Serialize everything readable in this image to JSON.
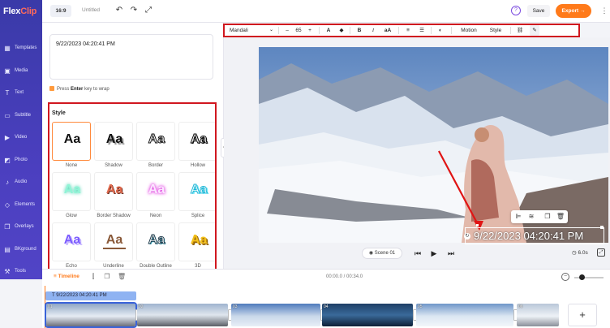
{
  "app": {
    "logo_main": "Flex",
    "logo_accent": "Clip"
  },
  "nav": [
    {
      "label": "Templates",
      "icon": "templates-icon",
      "glyph": "▦"
    },
    {
      "label": "Media",
      "icon": "media-icon",
      "glyph": "▣"
    },
    {
      "label": "Text",
      "icon": "text-icon",
      "glyph": "T"
    },
    {
      "label": "Subtitle",
      "icon": "subtitle-icon",
      "glyph": "▭"
    },
    {
      "label": "Video",
      "icon": "video-icon",
      "glyph": "▶"
    },
    {
      "label": "Photo",
      "icon": "photo-icon",
      "glyph": "◩"
    },
    {
      "label": "Audio",
      "icon": "audio-icon",
      "glyph": "♪"
    },
    {
      "label": "Elements",
      "icon": "elements-icon",
      "glyph": "◇"
    },
    {
      "label": "Overlays",
      "icon": "overlays-icon",
      "glyph": "❐"
    },
    {
      "label": "BKground",
      "icon": "background-icon",
      "glyph": "▤"
    },
    {
      "label": "Tools",
      "icon": "tools-icon",
      "glyph": "⚒"
    }
  ],
  "topbar": {
    "ratio": "16:9",
    "title": "Untitled",
    "save": "Save",
    "export": "Export →",
    "help": "?"
  },
  "texttoolbar": {
    "font": "Mandali",
    "font_size": "65",
    "minus": "–",
    "plus": "+",
    "motion": "Motion",
    "style": "Style"
  },
  "panel": {
    "text_value": "9/22/2023 04:20:41 PM",
    "hint_prefix": "Press ",
    "hint_key": "Enter",
    "hint_suffix": " key to wrap",
    "style_title": "Style",
    "styles": [
      {
        "name": "None",
        "sample": "Aa"
      },
      {
        "name": "Shadow",
        "sample": "Aa"
      },
      {
        "name": "Border",
        "sample": "Aa"
      },
      {
        "name": "Hollow",
        "sample": "Aa"
      },
      {
        "name": "Glow",
        "sample": "Aa"
      },
      {
        "name": "Border Shadow",
        "sample": "Aa"
      },
      {
        "name": "Neon",
        "sample": "Aa"
      },
      {
        "name": "Splice",
        "sample": "Aa"
      },
      {
        "name": "Echo",
        "sample": "Aa"
      },
      {
        "name": "Underline",
        "sample": "Aa"
      },
      {
        "name": "Double Outline",
        "sample": "Aa"
      },
      {
        "name": "3D",
        "sample": "Aa"
      }
    ]
  },
  "canvas": {
    "overlay_text": "9/22/2023 04:20:41 PM",
    "scene_label": "Scene 01",
    "duration": "6.0s"
  },
  "timeline": {
    "tab": "Timeline",
    "time": "00:00.0 / 00:34.0",
    "text_track": "9/22/2023 04:20:41 PM",
    "clip_numbers": [
      "01",
      "02",
      "03",
      "04",
      "05",
      "06"
    ]
  },
  "colors": {
    "accent": "#ff7a1a",
    "nav": "#4b3fbf",
    "highlight": "#d0171f"
  }
}
